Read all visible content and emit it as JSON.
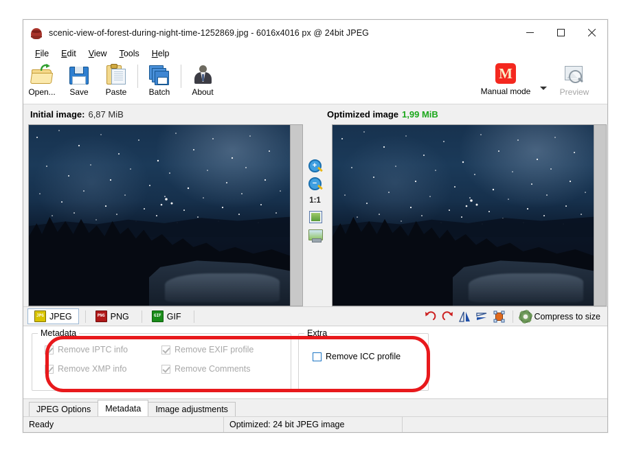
{
  "window": {
    "title": "scenic-view-of-forest-during-night-time-1252869.jpg - 6016x4016 px @ 24bit JPEG",
    "app_icon": "crab-icon",
    "minimize": "minimize-icon",
    "maximize": "maximize-icon",
    "close": "close-icon"
  },
  "menu": [
    {
      "accel": "F",
      "rest": "ile"
    },
    {
      "accel": "E",
      "rest": "dit"
    },
    {
      "accel": "V",
      "rest": "iew"
    },
    {
      "accel": "T",
      "rest": "ools"
    },
    {
      "accel": "H",
      "rest": "elp"
    }
  ],
  "toolbar": {
    "open_label": "Open...",
    "save_label": "Save",
    "paste_label": "Paste",
    "batch_label": "Batch",
    "about_label": "About",
    "mode_label": "Manual mode",
    "mode_badge": "M",
    "mode_badge_color": "#f4281f",
    "preview_label": "Preview"
  },
  "sizes": {
    "initial_label": "Initial image:",
    "initial_value": "6,87 MiB",
    "optimized_label": "Optimized image",
    "optimized_value": "1,99 MiB",
    "optimized_color": "#1aa71a"
  },
  "zoom_column": {
    "zoom_in": "+",
    "zoom_out": "−",
    "one_to_one": "1:1",
    "fit_label": "fit-to-window-icon",
    "screen_label": "full-screen-icon"
  },
  "format_tabs": [
    {
      "label": "JPEG",
      "badge": "JPG",
      "active": true
    },
    {
      "label": "PNG",
      "badge": "PNG",
      "active": false
    },
    {
      "label": "GIF",
      "badge": "GIF",
      "active": false
    }
  ],
  "image_tools": {
    "rotate_left": "rotate-left-icon",
    "rotate_right": "rotate-right-icon",
    "flip_horizontal": "flip-horizontal-icon",
    "flip_vertical": "flip-vertical-icon",
    "crop": "crop-icon",
    "compress_label": "Compress to size"
  },
  "metadata_group": {
    "legend": "Metadata",
    "checkboxes": [
      {
        "label": "Remove IPTC info",
        "checked": true,
        "enabled": false
      },
      {
        "label": "Remove EXIF profile",
        "checked": true,
        "enabled": false
      },
      {
        "label": "Remove XMP info",
        "checked": true,
        "enabled": false
      },
      {
        "label": "Remove Comments",
        "checked": true,
        "enabled": false
      }
    ]
  },
  "extra_group": {
    "legend": "Extra",
    "checkbox": {
      "label": "Remove ICC profile",
      "checked": false,
      "enabled": true
    }
  },
  "annotation": {
    "color": "#e8191c",
    "shape": "rounded-rectangle"
  },
  "bottom_tabs": [
    {
      "label": "JPEG Options",
      "active": false
    },
    {
      "label": "Metadata",
      "active": true
    },
    {
      "label": "Image adjustments",
      "active": false
    }
  ],
  "statusbar": {
    "state": "Ready",
    "optimized_info": "Optimized: 24 bit JPEG image",
    "extra": ""
  }
}
